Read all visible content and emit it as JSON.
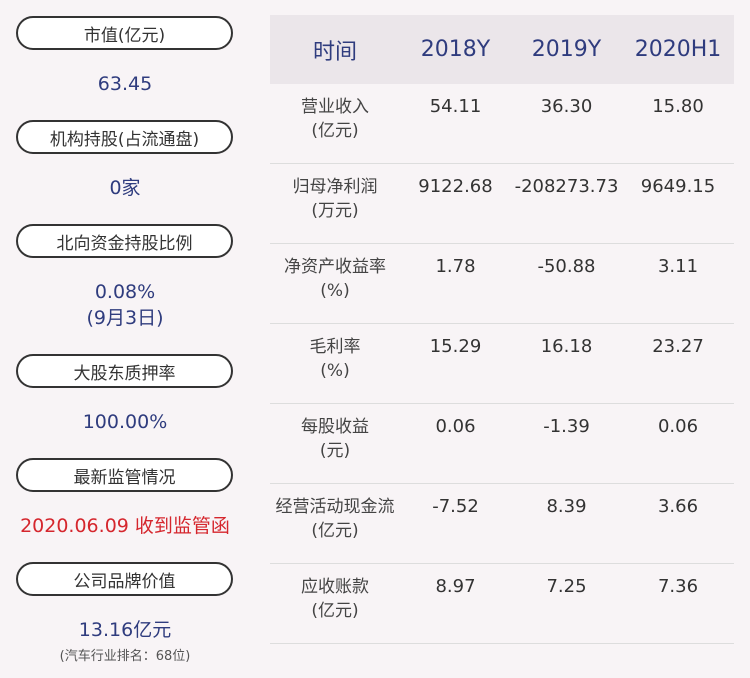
{
  "left": {
    "market_cap": {
      "label": "市值(亿元)",
      "value": "63.45"
    },
    "institutional": {
      "label": "机构持股(占流通盘)",
      "value": "0家"
    },
    "northbound": {
      "label": "北向资金持股比例",
      "value": "0.08%",
      "date": "(9月3日)"
    },
    "pledge": {
      "label": "大股东质押率",
      "value": "100.00%"
    },
    "regulation": {
      "label": "最新监管情况",
      "value": "2020.06.09 收到监管函"
    },
    "brand": {
      "label": "公司品牌价值",
      "value": "13.16亿元",
      "note": "(汽车行业排名：68位)"
    }
  },
  "table": {
    "headers": [
      "时间",
      "2018Y",
      "2019Y",
      "2020H1"
    ],
    "rows": [
      {
        "label1": "营业收入",
        "label2": "(亿元)",
        "v": [
          "54.11",
          "36.30",
          "15.80"
        ]
      },
      {
        "label1": "归母净利润",
        "label2": "(万元)",
        "v": [
          "9122.68",
          "-208273.73",
          "9649.15"
        ]
      },
      {
        "label1": "净资产收益率",
        "label2": "(%)",
        "v": [
          "1.78",
          "-50.88",
          "3.11"
        ]
      },
      {
        "label1": "毛利率",
        "label2": "(%)",
        "v": [
          "15.29",
          "16.18",
          "23.27"
        ]
      },
      {
        "label1": "每股收益",
        "label2": "(元)",
        "v": [
          "0.06",
          "-1.39",
          "0.06"
        ]
      },
      {
        "label1": "经营活动现金流",
        "label2": "(亿元)",
        "v": [
          "-7.52",
          "8.39",
          "3.66"
        ]
      },
      {
        "label1": "应收账款",
        "label2": "(亿元)",
        "v": [
          "8.97",
          "7.25",
          "7.36"
        ]
      }
    ]
  }
}
